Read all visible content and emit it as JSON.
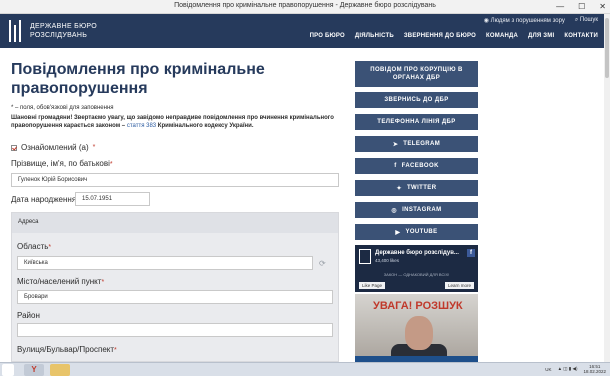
{
  "window": {
    "title": "Повідомлення про кримінальне правопорушення - Державне бюро розслідувань",
    "minimize": "—",
    "maximize": "☐",
    "close": "✕"
  },
  "header": {
    "brand_line1": "ДЕРЖАВНЕ БЮРО",
    "brand_line2": "РОЗСЛІДУВАНЬ",
    "accessibility_label": "Людям з порушенням зору",
    "search_label": "Пошук",
    "nav": [
      "ПРО БЮРО",
      "ДІЯЛЬНІСТЬ",
      "ЗВЕРНЕННЯ ДО БЮРО",
      "КОМАНДА",
      "ДЛЯ ЗМІ",
      "КОНТАКТИ"
    ]
  },
  "form": {
    "title": "Повідомлення про кримінальне правопорушення",
    "required_note": "* – поля, обов'язкові для заповнення",
    "warning_text": "Шановні громадяни! Звертаємо увагу, що завідомо неправдиве повідомлення про вчинення кримінального правопорушення карається законом –",
    "warning_link": "стаття 383",
    "warning_tail": "Кримінального кодексу України.",
    "acknowledged_label": "Ознайомлений (а)",
    "acknowledged_checked": true,
    "required_star": "*",
    "fullname_label": "Прізвище, ім'я, по батькові",
    "fullname_value": "Гуленок Юрій Борисович",
    "dob_label": "Дата народження",
    "dob_value": "15.07.1951",
    "address_header": "Адреса",
    "region_label": "Область",
    "region_value": "Київська",
    "city_label": "Місто/населений пункт",
    "city_value": "Бровари",
    "district_label": "Район",
    "district_value": "",
    "street_label": "Вулиця/Бульвар/Проспект",
    "street_value": ""
  },
  "sidebar": {
    "corruption_button": "ПОВІДОМ ПРО КОРУПЦІЮ В ОРГАНАХ ДБР",
    "contact_button": "ЗВЕРНИСЬ ДО ДБР",
    "phone_button": "ТЕЛЕФОННА ЛІНІЯ ДБР",
    "social": [
      {
        "label": "TELEGRAM",
        "icon": "➤"
      },
      {
        "label": "FACEBOOK",
        "icon": "f"
      },
      {
        "label": "TWITTER",
        "icon": "✦"
      },
      {
        "label": "INSTAGRAM",
        "icon": "◎"
      },
      {
        "label": "YOUTUBE",
        "icon": "▶"
      }
    ],
    "fb_widget": {
      "name": "Державне бюро розслідув...",
      "likes": "43,400 likes",
      "slogan": "ЗАКОН — ОДНАКОВИЙ ДЛЯ ВСІХ!",
      "like_label": "Like Page",
      "more_label": "Learn more"
    },
    "promo": {
      "title": "УВАГА! РОЗШУК"
    }
  },
  "taskbar": {
    "language": "UK",
    "time": "16:51",
    "date": "18.02.2022"
  }
}
